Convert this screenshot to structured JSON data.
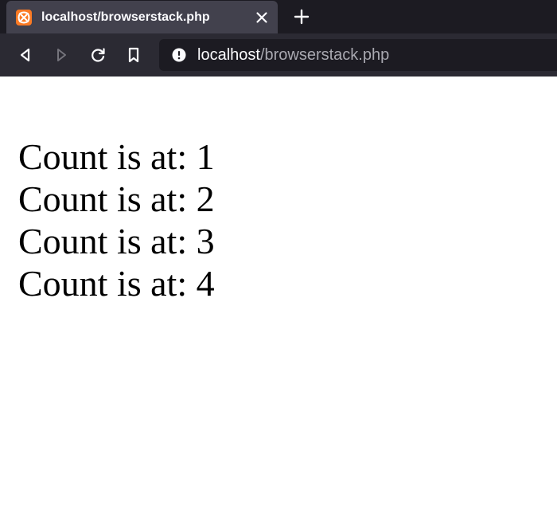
{
  "tab": {
    "title": "localhost/browserstack.php",
    "favicon": "xampp-icon"
  },
  "nav": {
    "icons": [
      "back-icon",
      "forward-icon",
      "reload-icon",
      "bookmark-icon"
    ]
  },
  "url": {
    "host": "localhost",
    "path": "/browserstack.php"
  },
  "content": {
    "lines": [
      "Count is at: 1",
      "Count is at: 2",
      "Count is at: 3",
      "Count is at: 4"
    ]
  },
  "colors": {
    "tabstrip": "#1c1b22",
    "active_tab": "#42414d",
    "toolbar": "#2b2a33",
    "favicon": "#fb7a24"
  }
}
